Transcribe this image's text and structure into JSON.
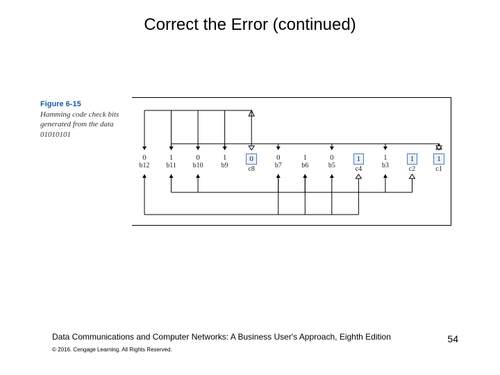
{
  "slide": {
    "title": "Correct the Error (continued)",
    "figure_number": "Figure 6-15",
    "figure_desc": "Hamming code check bits generated from the data 01010101",
    "book": "Data Communications and Computer Networks: A Business User's Approach, Eighth Edition",
    "copyright": "© 2016. Cengage Learning. All Rights Reserved.",
    "page": "54"
  },
  "bits": [
    {
      "value": "0",
      "label": "b12",
      "boxed": false
    },
    {
      "value": "1",
      "label": "b11",
      "boxed": false
    },
    {
      "value": "0",
      "label": "b10",
      "boxed": false
    },
    {
      "value": "1",
      "label": "b9",
      "boxed": false
    },
    {
      "value": "0",
      "label": "c8",
      "boxed": true
    },
    {
      "value": "0",
      "label": "b7",
      "boxed": false
    },
    {
      "value": "1",
      "label": "b6",
      "boxed": false
    },
    {
      "value": "0",
      "label": "b5",
      "boxed": false
    },
    {
      "value": "1",
      "label": "c4",
      "boxed": true
    },
    {
      "value": "1",
      "label": "b3",
      "boxed": false
    },
    {
      "value": "1",
      "label": "c2",
      "boxed": true
    },
    {
      "value": "1",
      "label": "c1",
      "boxed": true
    }
  ],
  "chart_data": {
    "type": "table",
    "title": "Hamming code check bits generated from the data 01010101",
    "positions": [
      "b12",
      "b11",
      "b10",
      "b9",
      "c8",
      "b7",
      "b6",
      "b5",
      "c4",
      "b3",
      "c2",
      "c1"
    ],
    "values": [
      "0",
      "1",
      "0",
      "1",
      "0",
      "0",
      "1",
      "0",
      "1",
      "1",
      "1",
      "1"
    ],
    "check_bit_positions": [
      "c8",
      "c4",
      "c2",
      "c1"
    ],
    "data_bit_positions": [
      "b12",
      "b11",
      "b10",
      "b9",
      "b7",
      "b6",
      "b5",
      "b3"
    ],
    "source_data_string": "01010101",
    "check_bit_dependencies": {
      "c8": [
        "b12",
        "b11",
        "b10",
        "b9"
      ],
      "c4": [
        "b12",
        "b7",
        "b6",
        "b5"
      ],
      "c2": [
        "b11",
        "b10",
        "b7",
        "b6",
        "b3"
      ],
      "c1": [
        "b11",
        "b9",
        "b7",
        "b5",
        "b3"
      ]
    }
  }
}
